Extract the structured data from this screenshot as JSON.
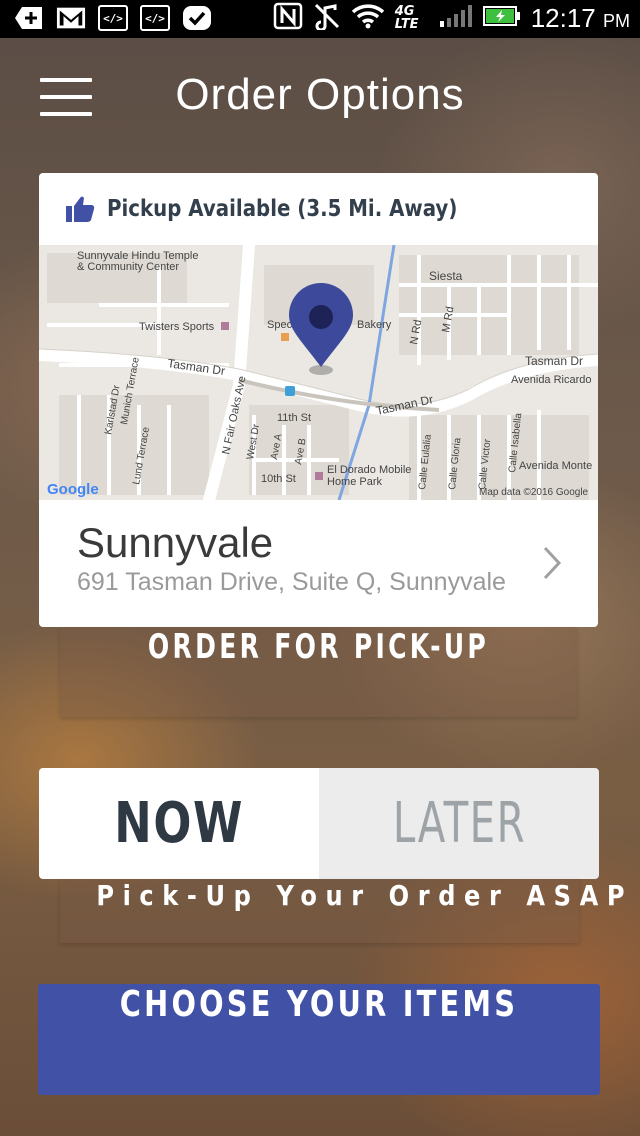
{
  "status_bar": {
    "time": "12:17",
    "ampm": "PM",
    "network": "4G LTE",
    "icons": [
      "add-icon",
      "gmail-icon",
      "code-icon",
      "code-icon",
      "check-icon",
      "nfc-icon",
      "mute-icon",
      "wifi-icon",
      "signal-icon",
      "battery-icon"
    ]
  },
  "header": {
    "title": "Order Options"
  },
  "location_card": {
    "availability": "Pickup Available (3.5 Mi. Away)",
    "name": "Sunnyvale",
    "address": "691 Tasman Drive, Suite Q, Sunnyvale",
    "map": {
      "labels": {
        "temple1": "Sunnyvale Hindu Temple",
        "temple2": "& Community Center",
        "twisters": "Twisters Sports",
        "bakery": "Bakery",
        "spec": "Spec",
        "siesta": "Siesta",
        "nrd": "N Rd",
        "mrd": "M Rd",
        "tasman_left": "Tasman Dr",
        "tasman_mid": "Tasman Dr",
        "tasman_right": "Tasman Dr",
        "avenida_ricardo": "Avenida Ricardo",
        "avenida_monte": "Avenida Monte",
        "karlstad": "Karlstad Dr",
        "munich": "Munich Terrace",
        "lund": "Lund Terrace",
        "fair_oaks": "N Fair Oaks Ave",
        "west_dr": "West Dr",
        "ave_a": "Ave A",
        "ave_b": "Ave B",
        "eleventh": "11th St",
        "tenth": "10th St",
        "eldorado1": "El Dorado Mobile",
        "eldorado2": "Home Park",
        "eulalia": "Calle Eulalia",
        "gloria": "Calle Gloria",
        "victor": "Calle Victor",
        "isabella": "Calle Isabella",
        "google": "Google",
        "attribution": "Map data ©2016 Google"
      }
    }
  },
  "buttons": {
    "order_pickup": "ORDER FOR PICK-UP",
    "now": "NOW",
    "later": "LATER",
    "asap": "Pick-Up Your Order ASAP",
    "choose_items": "CHOOSE YOUR ITEMS"
  },
  "colors": {
    "accent": "#4152a6",
    "pin": "#3d4a9b",
    "dark_text": "#2e3943"
  },
  "selected_timing": "NOW"
}
